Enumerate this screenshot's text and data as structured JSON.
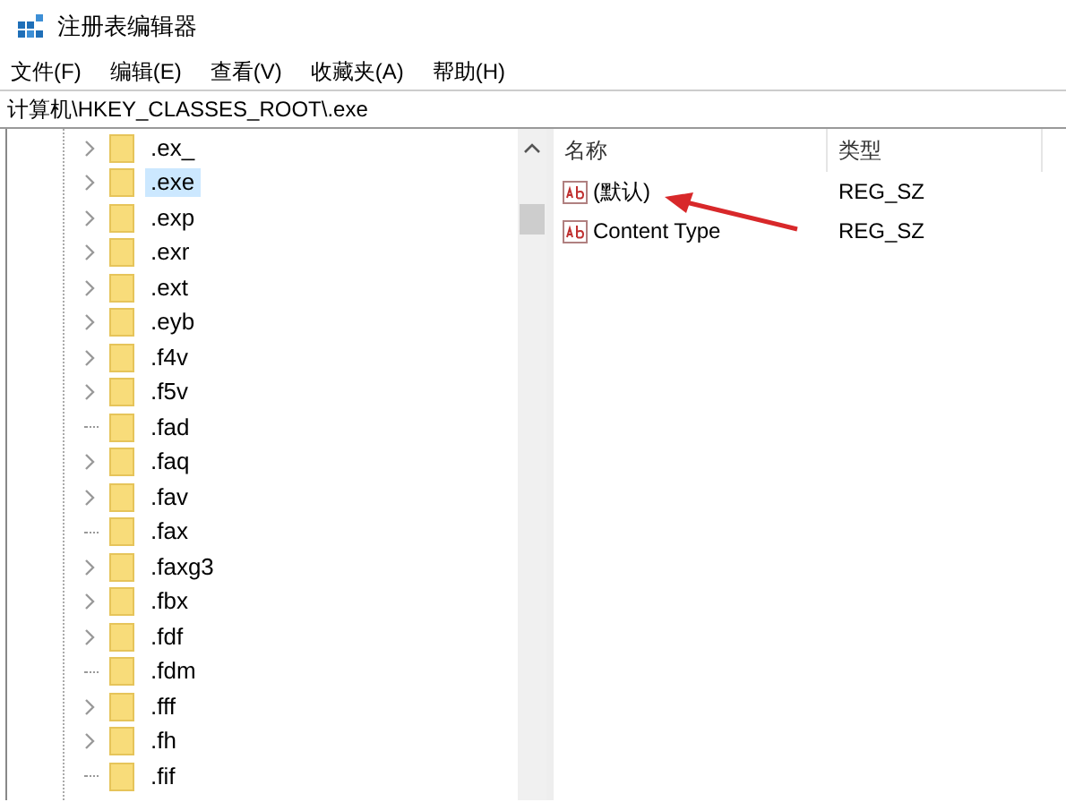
{
  "window": {
    "title": "注册表编辑器"
  },
  "menu": [
    "文件(F)",
    "编辑(E)",
    "查看(V)",
    "收藏夹(A)",
    "帮助(H)"
  ],
  "address": "计算机\\HKEY_CLASSES_ROOT\\.exe",
  "tree": [
    {
      "name": ".ex_",
      "expandable": true,
      "selected": false
    },
    {
      "name": ".exe",
      "expandable": true,
      "selected": true
    },
    {
      "name": ".exp",
      "expandable": true,
      "selected": false
    },
    {
      "name": ".exr",
      "expandable": true,
      "selected": false
    },
    {
      "name": ".ext",
      "expandable": true,
      "selected": false
    },
    {
      "name": ".eyb",
      "expandable": true,
      "selected": false
    },
    {
      "name": ".f4v",
      "expandable": true,
      "selected": false
    },
    {
      "name": ".f5v",
      "expandable": true,
      "selected": false
    },
    {
      "name": ".fad",
      "expandable": false,
      "selected": false
    },
    {
      "name": ".faq",
      "expandable": true,
      "selected": false
    },
    {
      "name": ".fav",
      "expandable": true,
      "selected": false
    },
    {
      "name": ".fax",
      "expandable": false,
      "selected": false
    },
    {
      "name": ".faxg3",
      "expandable": true,
      "selected": false
    },
    {
      "name": ".fbx",
      "expandable": true,
      "selected": false
    },
    {
      "name": ".fdf",
      "expandable": true,
      "selected": false
    },
    {
      "name": ".fdm",
      "expandable": false,
      "selected": false
    },
    {
      "name": ".fff",
      "expandable": true,
      "selected": false
    },
    {
      "name": ".fh",
      "expandable": true,
      "selected": false
    },
    {
      "name": ".fif",
      "expandable": false,
      "selected": false
    }
  ],
  "values": {
    "columns": [
      "名称",
      "类型"
    ],
    "rows": [
      {
        "name": "(默认)",
        "type": "REG_SZ"
      },
      {
        "name": "Content Type",
        "type": "REG_SZ"
      }
    ]
  }
}
